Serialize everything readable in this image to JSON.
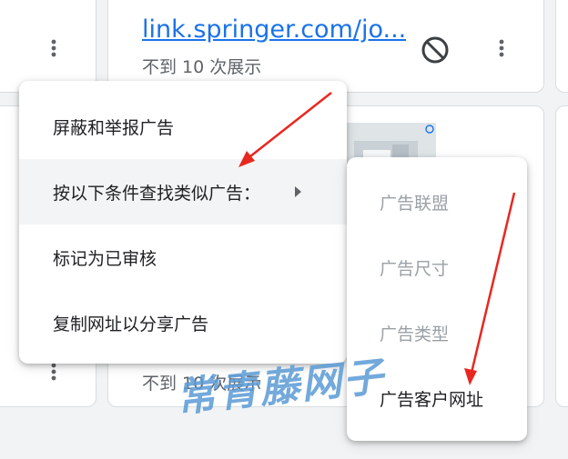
{
  "cards": {
    "top_link": "link.springer.com/jo...",
    "top_impressions": "不到 10 次展示",
    "bottom_impressions": "不到 10 次展示"
  },
  "context_menu": {
    "items": [
      {
        "label": "屏蔽和举报广告"
      },
      {
        "label": "按以下条件查找类似广告："
      },
      {
        "label": "标记为已审核"
      },
      {
        "label": "复制网址以分享广告"
      }
    ]
  },
  "submenu": {
    "items": [
      {
        "label": "广告联盟"
      },
      {
        "label": "广告尺寸"
      },
      {
        "label": "广告类型"
      },
      {
        "label": "广告客户网址"
      }
    ]
  },
  "watermark": "常青藤网子",
  "colors": {
    "link": "#1a73e8",
    "annotation_arrow": "#e8271f",
    "watermark": "#5b9bd5",
    "disabled_text": "#9aa0a6"
  },
  "icons": [
    "more-vert-icon",
    "block-icon",
    "chevron-right-icon",
    "ad-info-icon"
  ]
}
